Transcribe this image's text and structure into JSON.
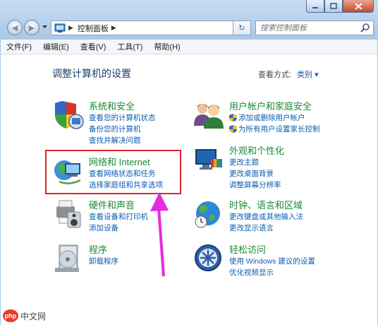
{
  "address": {
    "segment": "控制面板"
  },
  "search": {
    "placeholder": "搜索控制面板"
  },
  "menu": [
    "文件(F)",
    "编辑(E)",
    "查看(V)",
    "工具(T)",
    "帮助(H)"
  ],
  "heading": "调整计算机的设置",
  "view_by": {
    "label": "查看方式:",
    "value": "类别"
  },
  "categories": [
    {
      "title": "系统和安全",
      "links": [
        "查看您的计算机状态",
        "备份您的计算机",
        "查找并解决问题"
      ]
    },
    {
      "title": "网络和 Internet",
      "links": [
        "查看网络状态和任务",
        "选择家庭组和共享选项"
      ]
    },
    {
      "title": "硬件和声音",
      "links": [
        "查看设备和打印机",
        "添加设备"
      ]
    },
    {
      "title": "程序",
      "links": [
        "卸载程序"
      ]
    },
    {
      "title": "用户帐户和家庭安全",
      "links": [
        "添加或删除用户帐户",
        "为所有用户设置家长控制"
      ]
    },
    {
      "title": "外观和个性化",
      "links": [
        "更改主题",
        "更改桌面背景",
        "调整屏幕分辨率"
      ]
    },
    {
      "title": "时钟、语言和区域",
      "links": [
        "更改键盘或其他输入法",
        "更改显示语言"
      ]
    },
    {
      "title": "轻松访问",
      "links": [
        "使用 Windows 建议的设置",
        "优化视频显示"
      ]
    }
  ],
  "watermark": {
    "logo": "php",
    "text": "中文网"
  },
  "colors": {
    "category_title": "#1a8a37",
    "link": "#0b5cb2",
    "highlight": "#e3232c",
    "arrow": "#e32be0"
  }
}
